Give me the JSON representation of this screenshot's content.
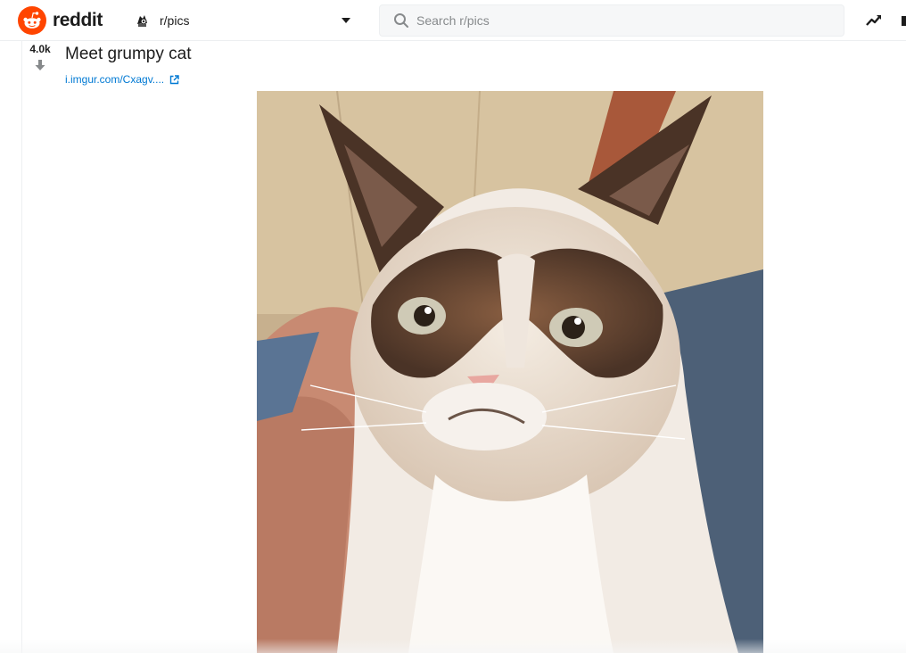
{
  "header": {
    "logo_text": "reddit",
    "community": "r/pics",
    "search_placeholder": "Search r/pics"
  },
  "icons": {
    "logo": "reddit-alien-icon",
    "community_avatar": "community-avatar-icon",
    "caret": "caret-down-icon",
    "search": "search-icon",
    "trending": "trending-icon",
    "downvote": "downvote-arrow-icon",
    "external": "external-link-icon"
  },
  "post": {
    "score": "4.0k",
    "title": "Meet grumpy cat",
    "link_text": "i.imgur.com/Cxagv...."
  },
  "colors": {
    "brand": "#ff4500",
    "link": "#0079d3",
    "text": "#1c1c1c",
    "search_bg": "#f6f7f8"
  }
}
